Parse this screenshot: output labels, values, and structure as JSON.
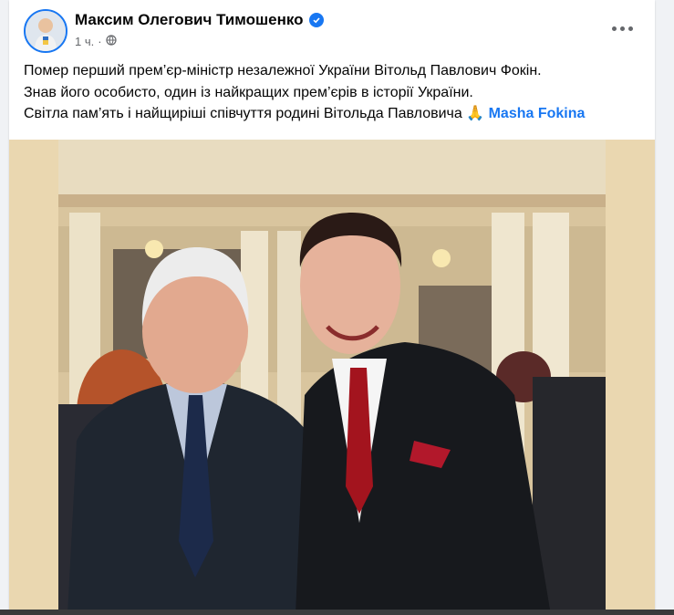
{
  "post": {
    "author": "Максим Олегович Тимошенко",
    "time": "1 ч.",
    "verified_icon": "verified-badge-icon",
    "audience_icon": "globe-icon",
    "menu_icon": "more-options-icon",
    "lines": [
      "Помер перший прем’єр-міністр незалежної України Вітольд Павлович Фокін.",
      "Знав його особисто, один із найкращих прем’єрів в історії України.",
      "Світла пам’ять і найщиріші співчуття родині Вітольда Павловича"
    ],
    "emoji": "🙏",
    "mention": "Masha Fokina",
    "photo_alt": "Two men posing in a hall"
  },
  "colors": {
    "accent": "#1877f2",
    "text": "#050505",
    "secondary": "#65676b",
    "photo_frame": "#ead7b0"
  }
}
